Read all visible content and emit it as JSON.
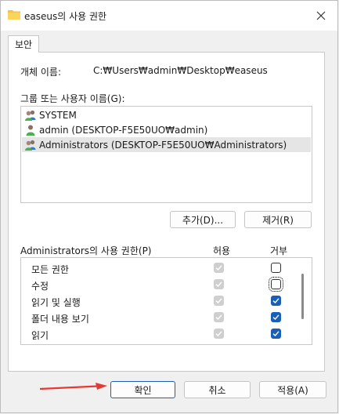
{
  "window": {
    "title": "easeus의 사용 권한"
  },
  "tab": {
    "label": "보안"
  },
  "object": {
    "label": "개체 이름:",
    "value": "C:₩Users₩admin₩Desktop₩easeus"
  },
  "groups": {
    "label": "그룹 또는 사용자 이름(G):",
    "items": [
      {
        "name": "SYSTEM",
        "icon": "group-users-icon"
      },
      {
        "name": "admin (DESKTOP-F5E50UO₩admin)",
        "icon": "user-icon"
      },
      {
        "name": "Administrators (DESKTOP-F5E50UO₩Administrators)",
        "icon": "group-users-icon",
        "selected": true
      }
    ],
    "add_label": "추가(D)...",
    "remove_label": "제거(R)"
  },
  "permissions": {
    "label": "Administrators의 사용 권한(P)",
    "allow_header": "허용",
    "deny_header": "거부",
    "rows": [
      {
        "name": "모든 권한",
        "allow": true,
        "deny": false
      },
      {
        "name": "수정",
        "allow": true,
        "deny": false
      },
      {
        "name": "읽기 및 실행",
        "allow": true,
        "deny": true
      },
      {
        "name": "폴더 내용 보기",
        "allow": true,
        "deny": true
      },
      {
        "name": "읽기",
        "allow": true,
        "deny": true
      }
    ]
  },
  "footer": {
    "ok_label": "확인",
    "cancel_label": "취소",
    "apply_label": "적용(A)"
  },
  "colors": {
    "accent": "#1a5fb4",
    "arrow": "#e53935",
    "disabled_check": "#cfcfcf"
  }
}
